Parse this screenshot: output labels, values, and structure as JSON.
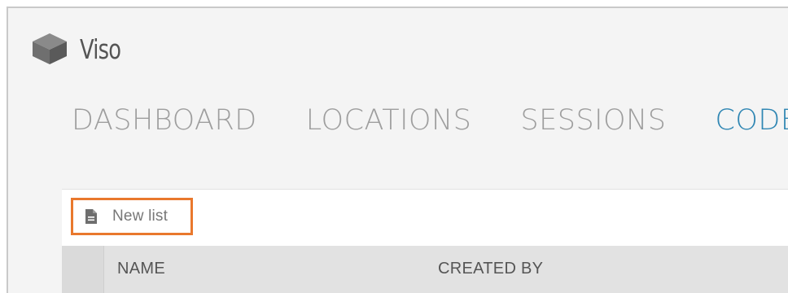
{
  "app": {
    "name": "Viso",
    "logo_icon": "cube-icon"
  },
  "nav": {
    "items": [
      {
        "label": "DASHBOARD",
        "active": false
      },
      {
        "label": "LOCATIONS",
        "active": false
      },
      {
        "label": "SESSIONS",
        "active": false
      },
      {
        "label": "CODES",
        "active": true
      }
    ],
    "active_color": "#2f86b3",
    "inactive_color": "#9e9e9e"
  },
  "toolbar": {
    "new_list_label": "New list",
    "new_list_icon": "document-icon",
    "highlight_color": "#e9782d"
  },
  "table": {
    "columns": [
      "NAME",
      "CREATED BY"
    ]
  }
}
